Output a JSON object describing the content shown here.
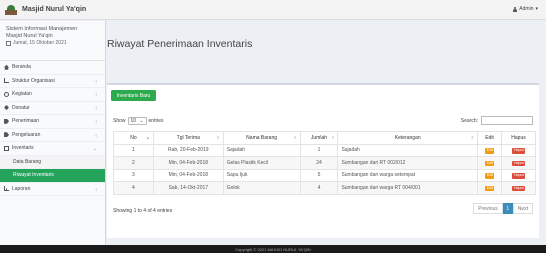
{
  "header": {
    "app_title": "Masjid Nurul Ya'qin",
    "user_label": "Admin",
    "user_caret": "▾"
  },
  "sidebar": {
    "system_line1": "Sistem Informasi Manajemen",
    "system_line2": "Masjid Nurul Ya'qin",
    "date": "Jumat, 15 Oktober 2021",
    "items": [
      {
        "label": "Beranda",
        "icon": "home-icon"
      },
      {
        "label": "Struktur Organisasi",
        "icon": "sitemap-icon"
      },
      {
        "label": "Kegiatan",
        "icon": "gear-icon"
      },
      {
        "label": "Donatur",
        "icon": "heart-icon"
      },
      {
        "label": "Penerimaan",
        "icon": "tag-icon"
      },
      {
        "label": "Pengeluaran",
        "icon": "tag-icon"
      },
      {
        "label": "Inventaris",
        "icon": "box-icon"
      },
      {
        "label": "Data Barang"
      },
      {
        "label": "Riwayat Inventaris"
      },
      {
        "label": "Laporan",
        "icon": "chart-icon"
      }
    ]
  },
  "main": {
    "title": "Riwayat Penerimaan Inventaris",
    "new_button": "Inventaris Baru",
    "show_label": "Show",
    "show_value": "10",
    "entries_label": "entries",
    "search_label": "Search:",
    "columns": [
      "No",
      "Tgl Terima",
      "Nama Barang",
      "Jumlah",
      "Keterangan",
      "Edit",
      "Hapus"
    ],
    "rows": [
      [
        "1",
        "Rab, 20-Feb-2019",
        "Sajadah",
        "1",
        "Sajadah"
      ],
      [
        "2",
        "Min, 04-Feb-2018",
        "Gelas Plastik Kecil",
        "24",
        "Sumbangan dari RT 002/012"
      ],
      [
        "3",
        "Min, 04-Feb-2018",
        "Sapu Ijuk",
        "5",
        "Sumbangan dari warga setempat"
      ],
      [
        "4",
        "Sab, 14-Okt-2017",
        "Golok",
        "4",
        "Sumbangan dari warga RT 004/001"
      ]
    ],
    "edit_label": "Edit",
    "hapus_label": "Hapus",
    "info": "Showing 1 to 4 of 4 entries",
    "pager": {
      "previous": "Previous",
      "current": "1",
      "next": "Next"
    }
  },
  "footer": "Copyright © 2021 MASJID NURUL YA'QIN",
  "colors": {
    "accent_green": "#24a35a",
    "edit": "#f39c12",
    "hapus": "#dd4b39",
    "page_blue": "#3c8dbc"
  }
}
